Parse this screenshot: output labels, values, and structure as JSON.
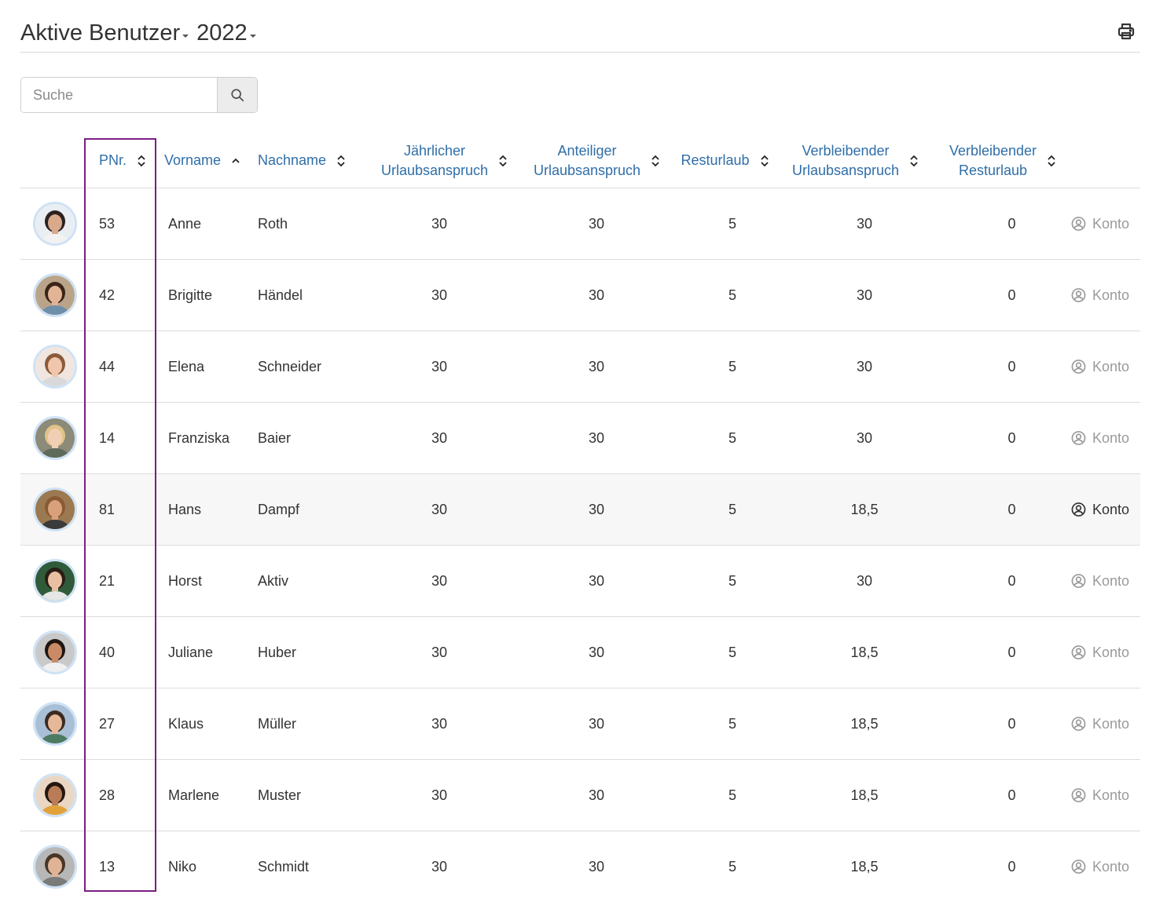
{
  "header": {
    "title": "Aktive Benutzer",
    "year": "2022"
  },
  "search": {
    "placeholder": "Suche"
  },
  "columns": {
    "pnr": "PNr.",
    "vorname": "Vorname",
    "nachname": "Nachname",
    "jahr_line1": "Jährlicher",
    "jahr_line2": "Urlaubsanspruch",
    "ant_line1": "Anteiliger",
    "ant_line2": "Urlaubsanspruch",
    "resturlaub": "Resturlaub",
    "verbl_ua_line1": "Verbleibender",
    "verbl_ua_line2": "Urlaubsanspruch",
    "verbl_ru_line1": "Verbleibender",
    "verbl_ru_line2": "Resturlaub"
  },
  "rows": [
    {
      "pnr": "53",
      "vorname": "Anne",
      "nachname": "Roth",
      "jahr": "30",
      "anteilig": "30",
      "rest": "5",
      "verbl_ua": "30",
      "verbl_ru": "0",
      "konto": "Konto",
      "avatar_bg": "#e9eef3",
      "skin": "#d9a98c",
      "hair": "#2b2220",
      "shirt": "#f2f2f2"
    },
    {
      "pnr": "42",
      "vorname": "Brigitte",
      "nachname": "Händel",
      "jahr": "30",
      "anteilig": "30",
      "rest": "5",
      "verbl_ua": "30",
      "verbl_ru": "0",
      "konto": "Konto",
      "avatar_bg": "#b9a48a",
      "skin": "#e2b395",
      "hair": "#3a2418",
      "shirt": "#6e8fa9"
    },
    {
      "pnr": "44",
      "vorname": "Elena",
      "nachname": "Schneider",
      "jahr": "30",
      "anteilig": "30",
      "rest": "5",
      "verbl_ua": "30",
      "verbl_ru": "0",
      "konto": "Konto",
      "avatar_bg": "#f1e6df",
      "skin": "#f0c7ad",
      "hair": "#8a5a3a",
      "shirt": "#d9d9d9"
    },
    {
      "pnr": "14",
      "vorname": "Franziska",
      "nachname": "Baier",
      "jahr": "30",
      "anteilig": "30",
      "rest": "5",
      "verbl_ua": "30",
      "verbl_ru": "0",
      "konto": "Konto",
      "avatar_bg": "#8c8a78",
      "skin": "#f1cfb7",
      "hair": "#e0c389",
      "shirt": "#5e6a5a"
    },
    {
      "pnr": "81",
      "vorname": "Hans",
      "nachname": "Dampf",
      "jahr": "30",
      "anteilig": "30",
      "rest": "5",
      "verbl_ua": "18,5",
      "verbl_ru": "0",
      "konto": "Konto",
      "avatar_bg": "#9b7a52",
      "skin": "#d8a17c",
      "hair": "#8a5a34",
      "shirt": "#3b3b3b",
      "highlight": true
    },
    {
      "pnr": "21",
      "vorname": "Horst",
      "nachname": "Aktiv",
      "jahr": "30",
      "anteilig": "30",
      "rest": "5",
      "verbl_ua": "30",
      "verbl_ru": "0",
      "konto": "Konto",
      "avatar_bg": "#2f5b3a",
      "skin": "#e8bfa2",
      "hair": "#2a1d16",
      "shirt": "#e6e6e6"
    },
    {
      "pnr": "40",
      "vorname": "Juliane",
      "nachname": "Huber",
      "jahr": "30",
      "anteilig": "30",
      "rest": "5",
      "verbl_ua": "18,5",
      "verbl_ru": "0",
      "konto": "Konto",
      "avatar_bg": "#c9c9c9",
      "skin": "#c98b66",
      "hair": "#1f1612",
      "shirt": "#f0f0f0"
    },
    {
      "pnr": "27",
      "vorname": "Klaus",
      "nachname": "Müller",
      "jahr": "30",
      "anteilig": "30",
      "rest": "5",
      "verbl_ua": "18,5",
      "verbl_ru": "0",
      "konto": "Konto",
      "avatar_bg": "#a9bfd6",
      "skin": "#e6b898",
      "hair": "#3a2a20",
      "shirt": "#4d7a62"
    },
    {
      "pnr": "28",
      "vorname": "Marlene",
      "nachname": "Muster",
      "jahr": "30",
      "anteilig": "30",
      "rest": "5",
      "verbl_ua": "18,5",
      "verbl_ru": "0",
      "konto": "Konto",
      "avatar_bg": "#e9d7c3",
      "skin": "#b97c57",
      "hair": "#24170f",
      "shirt": "#e2a23a"
    },
    {
      "pnr": "13",
      "vorname": "Niko",
      "nachname": "Schmidt",
      "jahr": "30",
      "anteilig": "30",
      "rest": "5",
      "verbl_ua": "18,5",
      "verbl_ru": "0",
      "konto": "Konto",
      "avatar_bg": "#b7b7b7",
      "skin": "#e0b397",
      "hair": "#4a3626",
      "shirt": "#7a7a7a"
    }
  ]
}
